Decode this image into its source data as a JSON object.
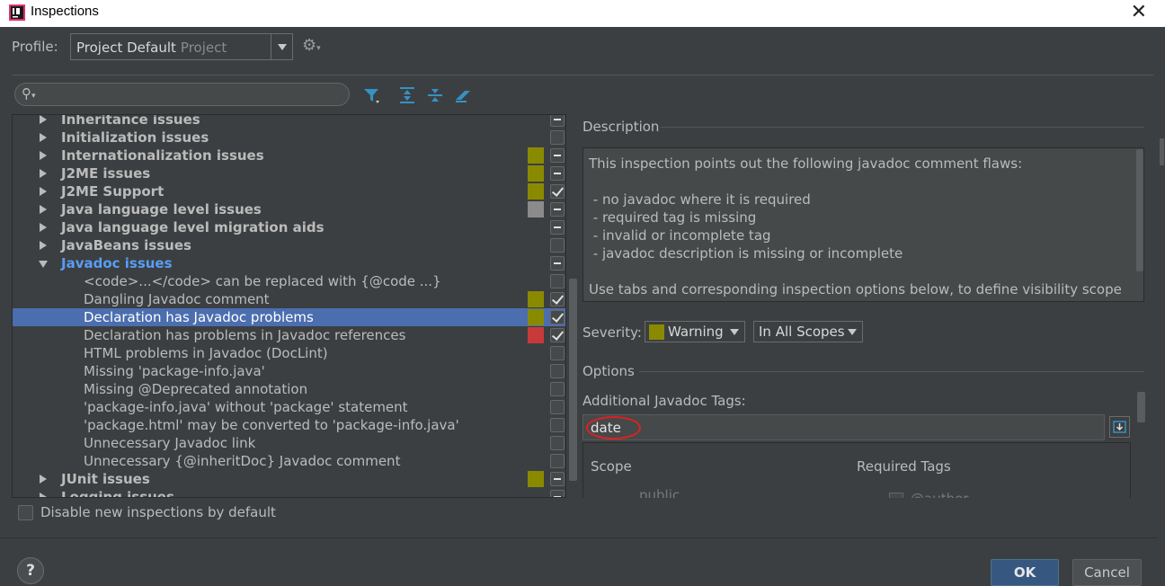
{
  "window": {
    "title": "Inspections",
    "close_label": "✕"
  },
  "profile": {
    "label": "Profile:",
    "value": "Project Default",
    "sub": "Project"
  },
  "tree": {
    "rows": [
      {
        "type": "group",
        "label": "Inheritance issues",
        "expanded": false,
        "severity": "",
        "check": "mixed"
      },
      {
        "type": "group",
        "label": "Initialization issues",
        "expanded": false,
        "severity": "",
        "check": "none"
      },
      {
        "type": "group",
        "label": "Internationalization issues",
        "expanded": false,
        "severity": "#8a8a00",
        "check": "mixed"
      },
      {
        "type": "group",
        "label": "J2ME issues",
        "expanded": false,
        "severity": "#8a8a00",
        "check": "mixed"
      },
      {
        "type": "group",
        "label": "J2ME Support",
        "expanded": false,
        "severity": "#8a8a00",
        "check": "checked"
      },
      {
        "type": "group",
        "label": "Java language level issues",
        "expanded": false,
        "severity": "#8b8b8b",
        "check": "mixed"
      },
      {
        "type": "group",
        "label": "Java language level migration aids",
        "expanded": false,
        "severity": "",
        "check": "mixed"
      },
      {
        "type": "group",
        "label": "JavaBeans issues",
        "expanded": false,
        "severity": "",
        "check": "none"
      },
      {
        "type": "group",
        "label": "Javadoc issues",
        "expanded": true,
        "severity": "",
        "check": "mixed",
        "link": true
      },
      {
        "type": "item",
        "label": "<code>...</code> can be replaced with {@code ...}",
        "severity": "",
        "check": "none"
      },
      {
        "type": "item",
        "label": "Dangling Javadoc comment",
        "severity": "#8a8a00",
        "check": "checked"
      },
      {
        "type": "item",
        "label": "Declaration has Javadoc problems",
        "severity": "#8a8a00",
        "check": "checked",
        "selected": true
      },
      {
        "type": "item",
        "label": "Declaration has problems in Javadoc references",
        "severity": "#c83a3a",
        "check": "checked"
      },
      {
        "type": "item",
        "label": "HTML problems in Javadoc (DocLint)",
        "severity": "",
        "check": "none"
      },
      {
        "type": "item",
        "label": "Missing 'package-info.java'",
        "severity": "",
        "check": "none"
      },
      {
        "type": "item",
        "label": "Missing @Deprecated annotation",
        "severity": "",
        "check": "none"
      },
      {
        "type": "item",
        "label": "'package-info.java' without 'package' statement",
        "severity": "",
        "check": "none"
      },
      {
        "type": "item",
        "label": "'package.html' may be converted to 'package-info.java'",
        "severity": "",
        "check": "none"
      },
      {
        "type": "item",
        "label": "Unnecessary Javadoc link",
        "severity": "",
        "check": "none"
      },
      {
        "type": "item",
        "label": "Unnecessary {@inheritDoc} Javadoc comment",
        "severity": "",
        "check": "none"
      },
      {
        "type": "group",
        "label": "JUnit issues",
        "expanded": false,
        "severity": "#8a8a00",
        "check": "mixed"
      },
      {
        "type": "group",
        "label": "Logging issues",
        "expanded": false,
        "severity": "",
        "check": "mixed"
      }
    ]
  },
  "disable_new": {
    "label": "Disable new inspections by default"
  },
  "description": {
    "title": "Description",
    "text": "This inspection points out the following javadoc comment flaws:\n\n - no javadoc where it is required\n - required tag is missing\n - invalid or incomplete tag\n - javadoc description is missing or incomplete\n\nUse tabs and corresponding inspection options below, to define visibility scope"
  },
  "severity": {
    "label": "Severity:",
    "value": "Warning",
    "color": "#8a8a00",
    "scope": "In All Scopes"
  },
  "options": {
    "title": "Options",
    "tags_label": "Additional Javadoc Tags:",
    "tags_value": "date",
    "scope_header": "Scope",
    "required_header": "Required Tags",
    "scope_first": "public",
    "required_first": "@author"
  },
  "buttons": {
    "help": "?",
    "ok": "OK",
    "cancel": "Cancel"
  }
}
